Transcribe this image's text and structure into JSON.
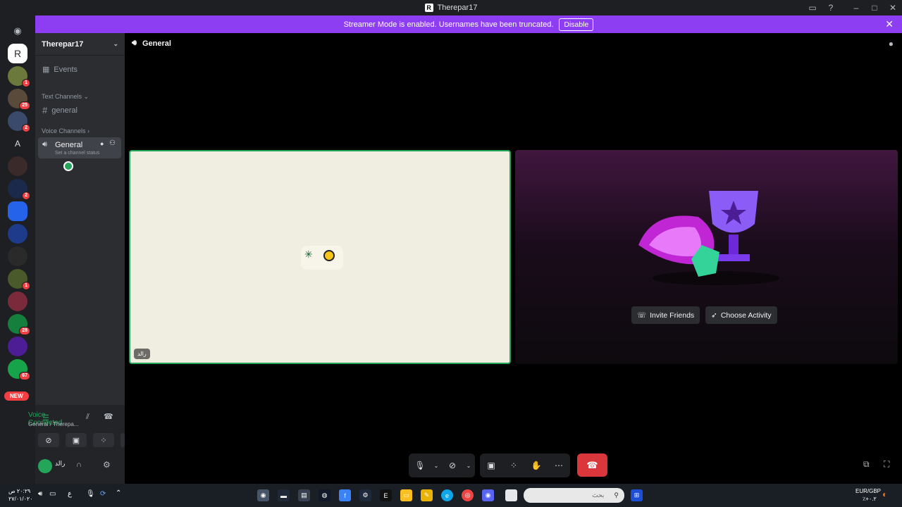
{
  "window": {
    "title": "Therepar17"
  },
  "banner": {
    "text": "Streamer Mode is enabled. Usernames have been truncated.",
    "disable_label": "Disable"
  },
  "guilds": {
    "badges": [
      "1",
      "25",
      "2",
      "2",
      "1",
      "28",
      "67"
    ],
    "letter_server": "A",
    "new_label": "NEW"
  },
  "sidebar": {
    "server_name": "Therepar17",
    "events_label": "Events",
    "text_category": "Text Channels",
    "text_channel": "general",
    "voice_category": "Voice Channels",
    "voice_channel": "General",
    "channel_status": "Set a channel status"
  },
  "voice_panel": {
    "status": "Voice Connected",
    "location": "General / Therepa..."
  },
  "user_panel": {
    "username": "رالد"
  },
  "main": {
    "channel_name": "General",
    "tile_name": "رالد",
    "invite_label": "Invite Friends",
    "activity_label": "Choose Activity"
  },
  "taskbar": {
    "search_placeholder": "بحث",
    "time": "٢٠:٢٩ ص",
    "date": "٢٧/٠١/٠٢٠",
    "currency": "EUR/GBP",
    "currency_change": "٪+٠.٢"
  },
  "colors": {
    "accent": "#8e3ef2",
    "connected": "#23a55a",
    "danger": "#da373c"
  }
}
